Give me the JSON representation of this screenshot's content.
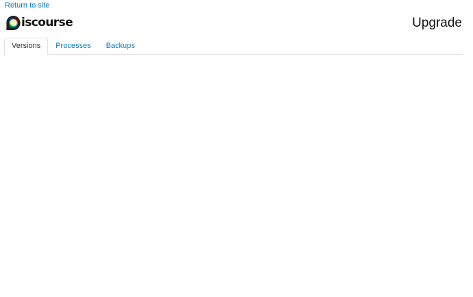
{
  "header": {
    "return_link": "Return to site",
    "logo_text": "iscourse",
    "page_title": "Upgrade"
  },
  "tabs": [
    {
      "label": "Versions",
      "active": true
    },
    {
      "label": "Processes",
      "active": false
    },
    {
      "label": "Backups",
      "active": false
    }
  ],
  "colors": {
    "link": "#0a7ac9",
    "logo_bubble": "#231f20",
    "logo_yellow": "#fff9ae",
    "logo_blue": "#00aeef",
    "logo_green": "#00a94f",
    "logo_red": "#ed1c24"
  }
}
